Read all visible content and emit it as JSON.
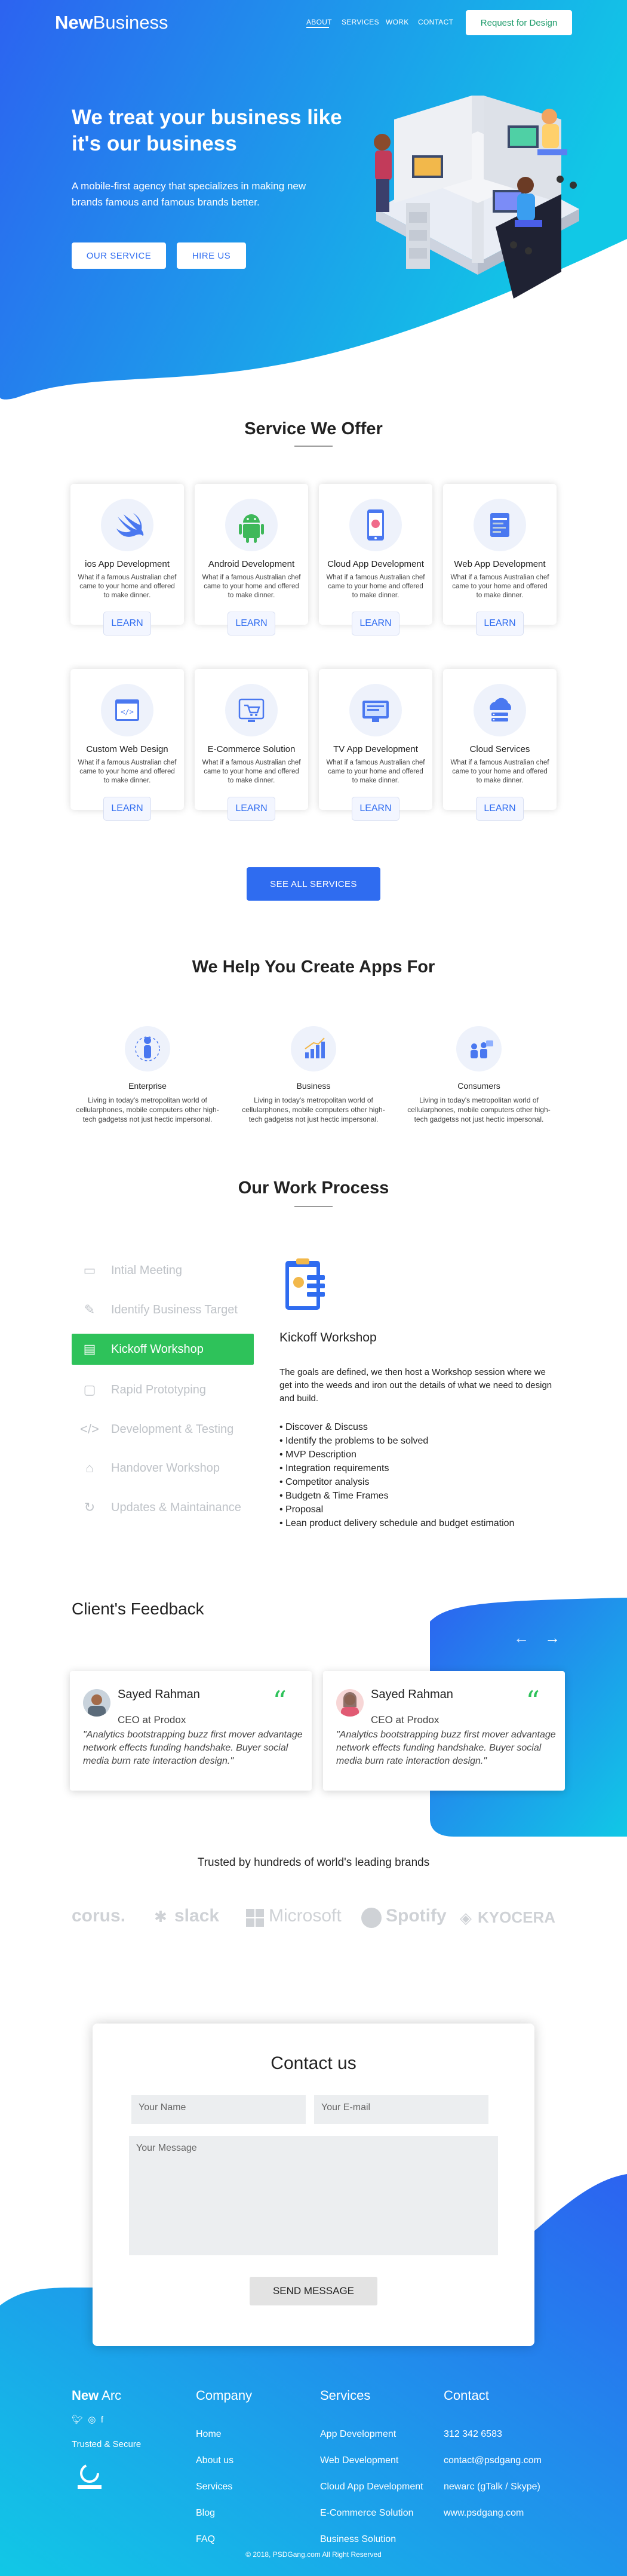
{
  "header": {
    "logo_bold": "New",
    "logo_light": "Business",
    "nav": [
      "ABOUT",
      "SERVICES",
      "WORK",
      "CONTACT"
    ],
    "cta": "Request for Design"
  },
  "hero": {
    "title": "We treat your business like it's our business",
    "subtitle": "A mobile-first agency that specializes in making new brands famous and famous brands better.",
    "btn_service": "OUR SERVICE",
    "btn_hire": "HIRE US"
  },
  "services": {
    "title": "Service We Offer",
    "learn": "LEARN",
    "desc": "What if a famous Australian chef came to your home and offered to make dinner.",
    "items": [
      {
        "title": "ios App Development",
        "icon": "swift-icon"
      },
      {
        "title": "Android Development",
        "icon": "android-icon"
      },
      {
        "title": "Cloud App Development",
        "icon": "mobile-cloud-icon"
      },
      {
        "title": "Web App Development",
        "icon": "web-app-icon"
      },
      {
        "title": "Custom Web Design",
        "icon": "code-browser-icon"
      },
      {
        "title": "E-Commerce Solution",
        "icon": "cart-icon"
      },
      {
        "title": "TV App Development",
        "icon": "tv-icon"
      },
      {
        "title": "Cloud Services",
        "icon": "cloud-server-icon"
      }
    ],
    "see_all": "SEE ALL SERVICES"
  },
  "help": {
    "title": "We Help You Create Apps For",
    "items": [
      {
        "title": "Enterprise",
        "desc": "Living in today's metropolitan world of cellularphones, mobile computers other high-tech gadgetss not just hectic impersonal."
      },
      {
        "title": "Business",
        "desc": "Living in today's metropolitan world of cellularphones, mobile computers other high-tech gadgetss not just hectic impersonal."
      },
      {
        "title": "Consumers",
        "desc": "Living in today's metropolitan world of cellularphones, mobile computers other high-tech gadgetss not just hectic impersonal."
      }
    ]
  },
  "process": {
    "title": "Our Work Process",
    "steps": [
      {
        "label": "Intial Meeting",
        "icon": "chat-icon"
      },
      {
        "label": "Identify Business Target",
        "icon": "edit-icon"
      },
      {
        "label": "Kickoff Workshop",
        "icon": "clipboard-icon"
      },
      {
        "label": "Rapid Prototyping",
        "icon": "prototype-icon"
      },
      {
        "label": "Development & Testing",
        "icon": "code-icon"
      },
      {
        "label": "Handover Workshop",
        "icon": "handover-icon"
      },
      {
        "label": "Updates & Maintainance",
        "icon": "refresh-icon"
      }
    ],
    "active_index": 2,
    "detail_title": "Kickoff Workshop",
    "detail_text": "The goals are defined, we then host a Workshop session where we get into the weeds and iron out the details of what we need to design and build.",
    "bullets": [
      "Discover & Discuss",
      "Identify the problems to be solved",
      "MVP Description",
      "Integration requirements",
      "Competitor analysis",
      "Budgetn & Time Frames",
      "Proposal",
      "Lean product delivery schedule and budget estimation"
    ]
  },
  "feedback": {
    "title": "Client's Feedback",
    "items": [
      {
        "name": "Sayed Rahman",
        "role": "CEO at Prodox",
        "quote": "\"Analytics bootstrapping buzz first mover advantage network effects funding handshake. Buyer social media burn rate interaction design.\""
      },
      {
        "name": "Sayed Rahman",
        "role": "CEO at Prodox",
        "quote": "\"Analytics bootstrapping buzz first mover advantage network effects funding handshake. Buyer social media burn rate interaction design.\""
      }
    ]
  },
  "brands": {
    "title": "Trusted by hundreds of world's leading brands",
    "items": [
      "corus.",
      "slack",
      "Microsoft",
      "Spotify",
      "KYOCERA"
    ]
  },
  "contact": {
    "title": "Contact us",
    "name_placeholder": "Your Name",
    "email_placeholder": "Your E-mail",
    "message_placeholder": "Your Message",
    "send": "SEND MESSAGE"
  },
  "footer": {
    "brand_bold": "New",
    "brand_light": "Arc",
    "trusted": "Trusted & Secure",
    "company": {
      "title": "Company",
      "items": [
        "Home",
        "About us",
        "Services",
        "Blog",
        "FAQ"
      ]
    },
    "services": {
      "title": "Services",
      "items": [
        "App Development",
        "Web Development",
        "Cloud App Development",
        "E-Commerce Solution",
        "Business Solution"
      ]
    },
    "contact": {
      "title": "Contact",
      "items": [
        "312 342 6583",
        "contact@psdgang.com",
        "newarc (gTalk / Skype)",
        "www.psdgang.com"
      ]
    },
    "copyright": "© 2018, PSDGang.com All Right Reserved"
  }
}
